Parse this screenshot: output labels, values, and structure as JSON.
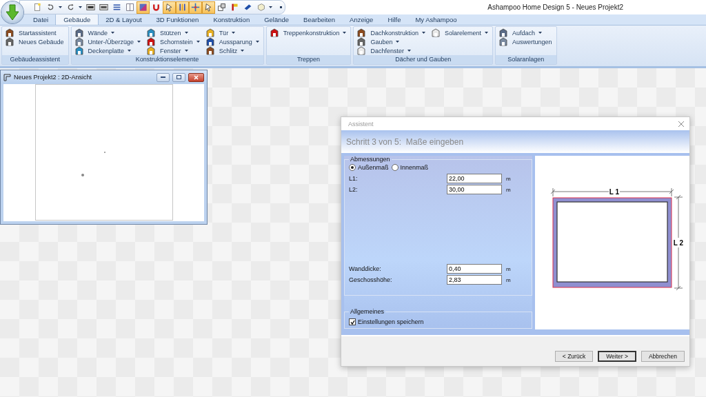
{
  "window": {
    "title": "Ashampoo Home Design 5 - Neues Projekt2"
  },
  "quick_access": [
    {
      "on": false,
      "dropdown": false
    },
    {
      "on": false,
      "dropdown": true
    },
    {
      "on": false,
      "dropdown": true
    },
    {
      "on": false,
      "dropdown": false
    },
    {
      "on": false,
      "dropdown": false
    },
    {
      "on": false,
      "dropdown": false
    },
    {
      "on": false,
      "dropdown": false
    },
    {
      "on": true,
      "dropdown": false
    },
    {
      "on": false,
      "dropdown": false
    },
    {
      "on": true,
      "dropdown": false
    },
    {
      "on": true,
      "dropdown": false
    },
    {
      "on": true,
      "dropdown": false
    },
    {
      "on": true,
      "dropdown": false
    },
    {
      "on": false,
      "dropdown": false
    },
    {
      "on": false,
      "dropdown": false
    },
    {
      "on": false,
      "dropdown": false
    },
    {
      "on": false,
      "dropdown": true
    }
  ],
  "tabs": [
    {
      "label": "Datei",
      "selected": false
    },
    {
      "label": "Gebäude",
      "selected": true
    },
    {
      "label": "2D & Layout",
      "selected": false
    },
    {
      "label": "3D Funktionen",
      "selected": false
    },
    {
      "label": "Konstruktion",
      "selected": false
    },
    {
      "label": "Gelände",
      "selected": false
    },
    {
      "label": "Bearbeiten",
      "selected": false
    },
    {
      "label": "Anzeige",
      "selected": false
    },
    {
      "label": "Hilfe",
      "selected": false
    },
    {
      "label": "My Ashampoo",
      "selected": false
    }
  ],
  "ribbon_groups": [
    {
      "label": "Gebäudeassistent",
      "columns": [
        [
          {
            "label": "Startassistent",
            "dropdown": false
          },
          {
            "label": "Neues Gebäude",
            "dropdown": false
          }
        ]
      ]
    },
    {
      "label": "Konstruktionselemente",
      "columns": [
        [
          {
            "label": "Wände",
            "dropdown": true
          },
          {
            "label": "Unter-/Überzüge",
            "dropdown": true
          },
          {
            "label": "Deckenplatte",
            "dropdown": true
          }
        ],
        [
          {
            "label": "Stützen",
            "dropdown": true
          },
          {
            "label": "Schornstein",
            "dropdown": true
          },
          {
            "label": "Fenster",
            "dropdown": true
          }
        ],
        [
          {
            "label": "Tür",
            "dropdown": true
          },
          {
            "label": "Aussparung",
            "dropdown": true
          },
          {
            "label": "Schlitz",
            "dropdown": true
          }
        ]
      ]
    },
    {
      "label": "Treppen",
      "columns": [
        [
          {
            "label": "Treppenkonstruktion",
            "dropdown": true
          }
        ]
      ]
    },
    {
      "label": "Dächer und Gauben",
      "columns": [
        [
          {
            "label": "Dachkonstruktion",
            "dropdown": true
          },
          {
            "label": "Gauben",
            "dropdown": true
          },
          {
            "label": "Dachfenster",
            "dropdown": true
          }
        ],
        [
          {
            "label": "Solarelement",
            "dropdown": true
          }
        ]
      ]
    },
    {
      "label": "Solaranlagen",
      "columns": [
        [
          {
            "label": "Aufdach",
            "dropdown": true
          },
          {
            "label": "Auswertungen",
            "dropdown": false
          }
        ]
      ]
    }
  ],
  "view_window": {
    "title": "Neues Projekt2 : 2D-Ansicht"
  },
  "dialog": {
    "title": "Assistent",
    "step": "Schritt 3 von 5:  Maße eingeben",
    "dimensions": {
      "legend": "Abmessungen",
      "options": [
        {
          "label": "Außenmaß",
          "selected": true
        },
        {
          "label": "Innenmaß",
          "selected": false
        }
      ],
      "fields": [
        {
          "label": "L1:",
          "value": "22,00",
          "unit": "m"
        },
        {
          "label": "L2:",
          "value": "30,00",
          "unit": "m"
        }
      ],
      "lower_fields": [
        {
          "label": "Wanddicke:",
          "value": "0,40",
          "unit": "m"
        },
        {
          "label": "Geschosshöhe:",
          "value": "2,83",
          "unit": "m"
        }
      ]
    },
    "general": {
      "legend": "Allgemeines",
      "checkbox": {
        "label": "Einstellungen speichern",
        "checked": true
      }
    },
    "preview": {
      "width_label": "L 1",
      "height_label": "L 2"
    },
    "buttons": [
      {
        "label": "< Zurück",
        "default": false
      },
      {
        "label": "Weiter >",
        "default": true
      },
      {
        "label": "Abbrechen",
        "default": false
      }
    ]
  }
}
